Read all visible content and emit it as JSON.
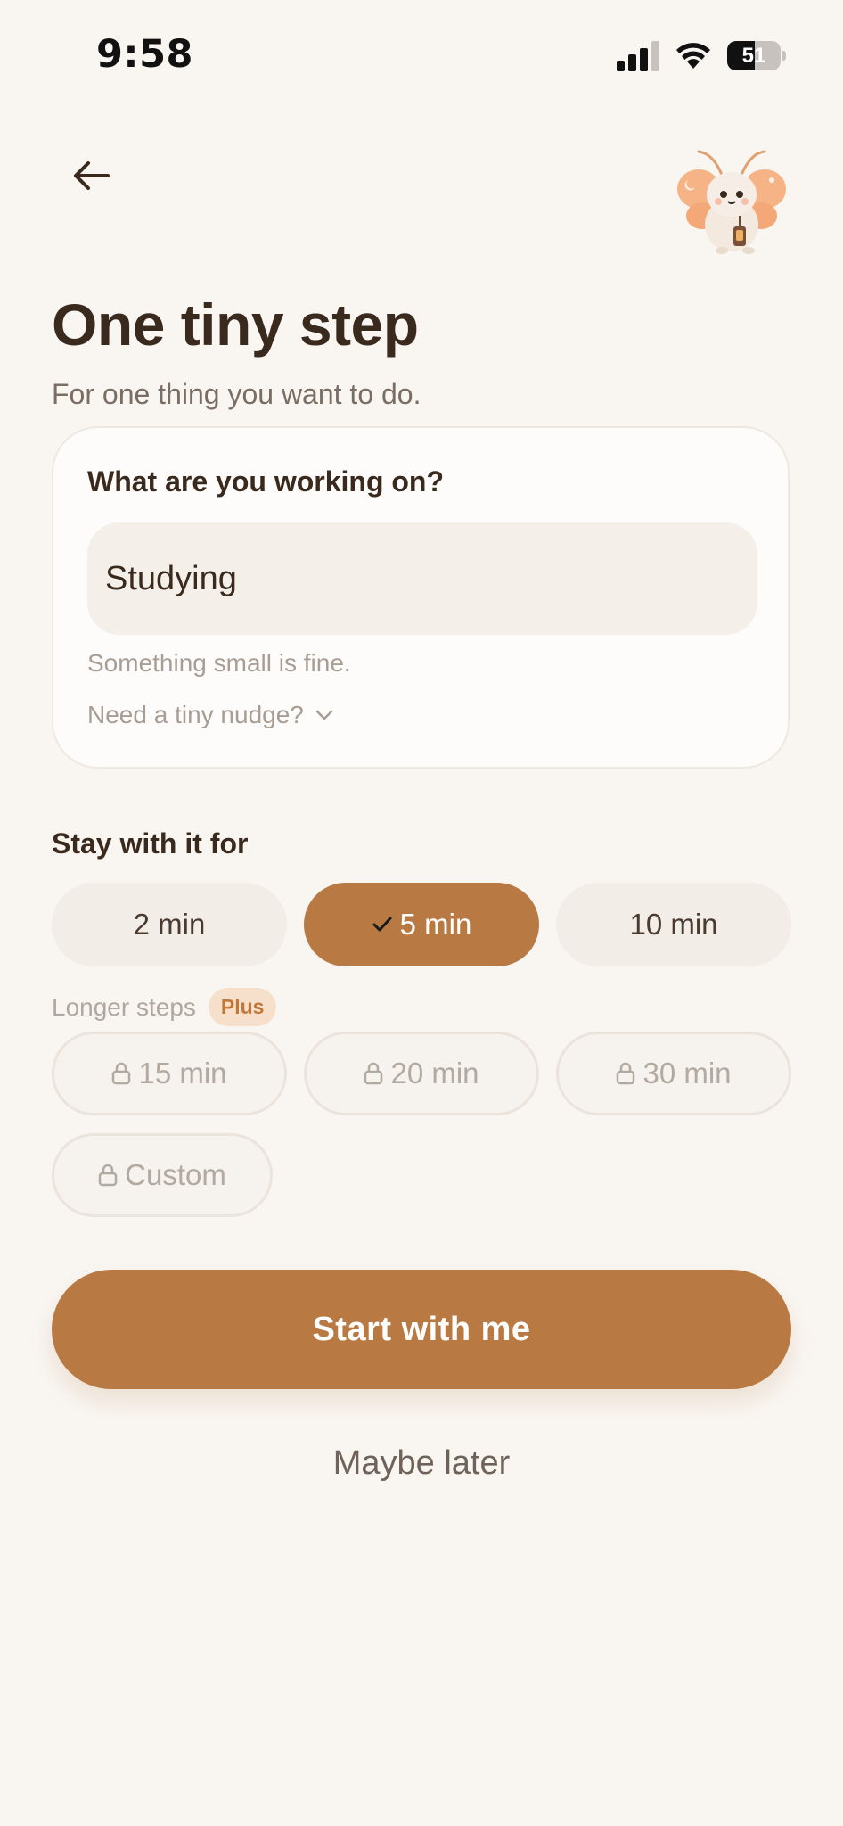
{
  "status_bar": {
    "time": "9:58",
    "battery": "51",
    "battery_level": 0.51
  },
  "header": {
    "back_icon": "arrow-left-icon",
    "mascot": "moth-mascot-with-lantern"
  },
  "title": "One tiny step",
  "subtitle": "For one thing you want to do.",
  "card": {
    "label": "What are you working on?",
    "input_value": "Studying",
    "hint": "Something small is fine.",
    "nudge_label": "Need a tiny nudge?"
  },
  "duration": {
    "label": "Stay with it for",
    "options": [
      {
        "label": "2 min",
        "selected": false
      },
      {
        "label": "5 min",
        "selected": true
      },
      {
        "label": "10 min",
        "selected": false
      }
    ],
    "longer_label": "Longer steps",
    "plus_badge": "Plus",
    "locked_options": [
      {
        "label": "15 min"
      },
      {
        "label": "20 min"
      },
      {
        "label": "30 min"
      },
      {
        "label": "Custom"
      }
    ]
  },
  "actions": {
    "start": "Start with me",
    "later": "Maybe later"
  },
  "colors": {
    "accent": "#b97943",
    "background": "#f9f6f2",
    "text": "#3a2a1e",
    "plus_badge_bg": "#f7e0cb"
  }
}
